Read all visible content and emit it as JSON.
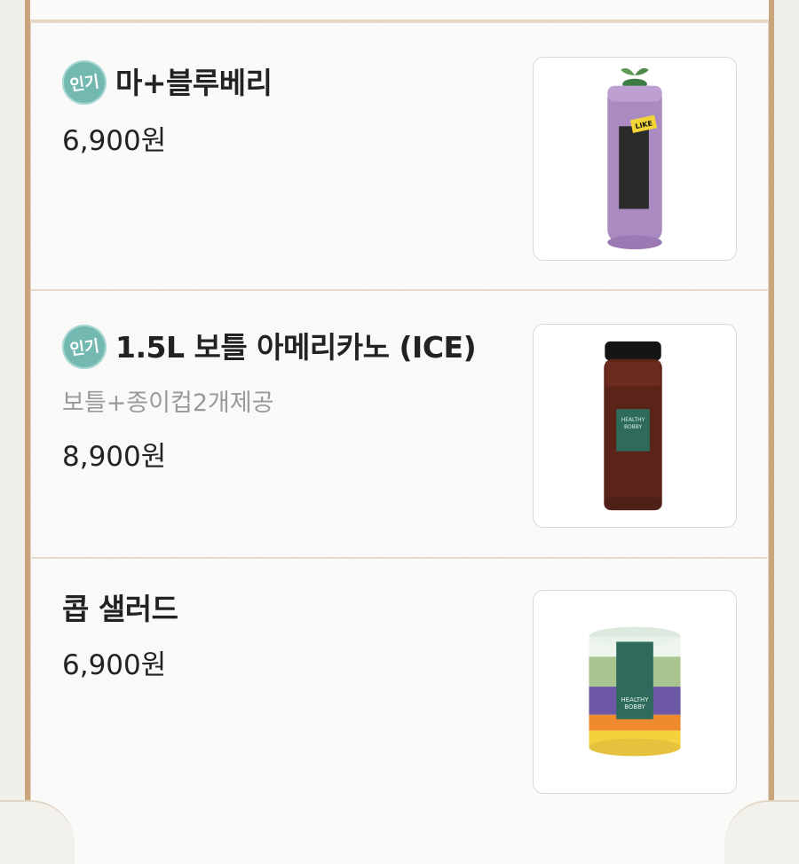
{
  "items": [
    {
      "badge": "인기",
      "title": "마+블루베리",
      "price": "6,900원"
    },
    {
      "badge": "인기",
      "title": "1.5L 보틀 아메리카노 (ICE)",
      "description": "보틀+종이컵2개제공",
      "price": "8,900원"
    },
    {
      "title": "콥 샐러드",
      "price": "6,900원"
    }
  ]
}
